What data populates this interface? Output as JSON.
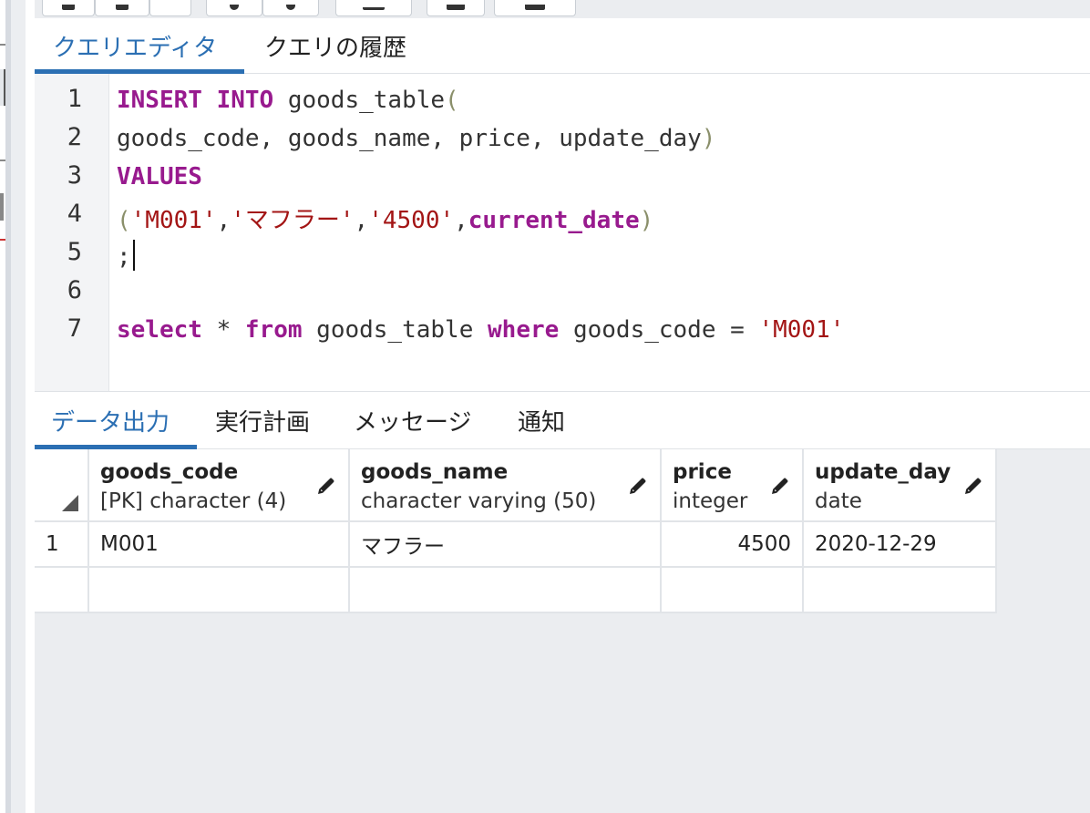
{
  "query_tabs": [
    {
      "label": "クエリエディタ",
      "active": true
    },
    {
      "label": "クエリの履歴",
      "active": false
    }
  ],
  "editor": {
    "line_numbers": [
      "1",
      "2",
      "3",
      "4",
      "5",
      "6",
      "7"
    ],
    "lines": {
      "l1_kw": "INSERT INTO",
      "l1_rest": " goods_table",
      "l1_paren": "(",
      "l2": "goods_code, goods_name, price, update_day",
      "l2_paren": ")",
      "l3_kw": "VALUES",
      "l4_paren_open": "(",
      "l4_s1": "'M001'",
      "l4_c1": ",",
      "l4_s2": "'マフラー'",
      "l4_c2": ",",
      "l4_s3": "'4500'",
      "l4_c3": ",",
      "l4_kw": "current_date",
      "l4_paren_close": ")",
      "l5": ";",
      "l7_kw1": "select",
      "l7_t1": " * ",
      "l7_kw2": "from",
      "l7_t2": " goods_table ",
      "l7_kw3": "where",
      "l7_t3": " goods_code = ",
      "l7_str": "'M001'"
    }
  },
  "output_tabs": [
    {
      "label": "データ出力",
      "active": true
    },
    {
      "label": "実行計画",
      "active": false
    },
    {
      "label": "メッセージ",
      "active": false
    },
    {
      "label": "通知",
      "active": false
    }
  ],
  "grid": {
    "columns": [
      {
        "name": "goods_code",
        "type": "[PK] character (4)"
      },
      {
        "name": "goods_name",
        "type": "character varying (50)"
      },
      {
        "name": "price",
        "type": "integer"
      },
      {
        "name": "update_day",
        "type": "date"
      }
    ],
    "rows": [
      {
        "row": "1",
        "goods_code": "M001",
        "goods_name": "マフラー",
        "price": "4500",
        "update_day": "2020-12-29"
      }
    ]
  },
  "colors": {
    "accent": "#2b6fb3",
    "keyword": "#981a8e",
    "string": "#a31515"
  },
  "icons": [
    "pencil-icon",
    "corner-icon"
  ]
}
